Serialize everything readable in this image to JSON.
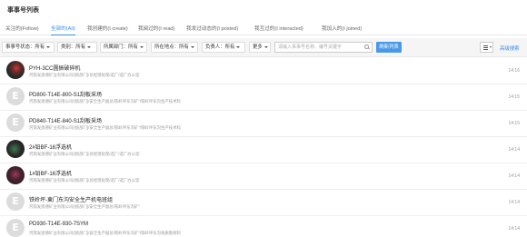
{
  "page_title": "事事号列表",
  "tabs": [
    {
      "label": "关注的(Follow)",
      "active": false
    },
    {
      "label": "全部的(All)",
      "active": true
    },
    {
      "label": "我创建的(I create)",
      "active": false
    },
    {
      "label": "我阅过的(I read)",
      "active": false
    },
    {
      "label": "我发过动态的(I posted)",
      "active": false
    },
    {
      "label": "我互过的(I interacted)",
      "active": false
    },
    {
      "label": "我加入的(I joined)",
      "active": false
    }
  ],
  "filters": {
    "status": {
      "label": "事事号状态：",
      "value": "所有"
    },
    "category": {
      "label": "类别：",
      "value": "所有"
    },
    "department": {
      "label": "所属部门：",
      "value": "所有"
    },
    "location": {
      "label": "所在地点：",
      "value": "所有"
    },
    "owner": {
      "label": "负责人：",
      "value": "所有"
    },
    "more": {
      "label": "更多"
    }
  },
  "search": {
    "placeholder": "请输入事事号名称、编号关键字"
  },
  "refresh_label": "刷新列表",
  "advanced_label": "高级搜索",
  "items": [
    {
      "name": "PYH-3CC圆振破碎机",
      "path": "河南发恩德矿业有限公司/[统部门]/总经理处理/选厂/选厂办公室",
      "time": "14:16",
      "avatar": "photo"
    },
    {
      "name": "PD800-T14E-800-S1刮板采场",
      "path": "河南发恩德矿业有限公司/[统部门]/安全生产副总/铁岭坪东沟矿\"/铁岭坪东沟生产技术科",
      "time": "14:15",
      "avatar": "default"
    },
    {
      "name": "PD840-T14E-840-S1刮板采场",
      "path": "河南发恩德矿业有限公司/[统部门]/安全生产副总/铁岭坪东沟矿\"/铁岭坪东沟生产技术科",
      "time": "14:15",
      "avatar": "default"
    },
    {
      "name": "2#铅BF-16浮选机",
      "path": "河南发恩德矿业有限公司/[统部门]/总经理处理/选厂/选厂办公室",
      "time": "14:14",
      "avatar": "photo2"
    },
    {
      "name": "1#铅BF-16浮选机",
      "path": "河南发恩德矿业有限公司/[统部门]/总经理处理/选厂/选厂办公室",
      "time": "14:14",
      "avatar": "photo3"
    },
    {
      "name": "铁岭坪-東门东沟安全生产机电班组",
      "path": "河南发恩德矿业有限公司/[统部门]/安全生产副总/铁岭坪东沟矿\"",
      "time": "14:14",
      "avatar": "default"
    },
    {
      "name": "PD930-T14E-930-7SYM",
      "path": "河南发恩德矿业有限公司/[统部门]/安全生产副总/铁岭坪东沟矿\"/铁岭坪东沟地质勘探科",
      "time": "14:14",
      "avatar": "default"
    }
  ],
  "colors": {
    "accent": "#3a8ee6",
    "button": "#4a98e8",
    "filter_bg": "#f5f5f5"
  },
  "icons": {
    "search": "search-icon",
    "menu": "menu-icon",
    "caret": "chevron-down-icon"
  }
}
